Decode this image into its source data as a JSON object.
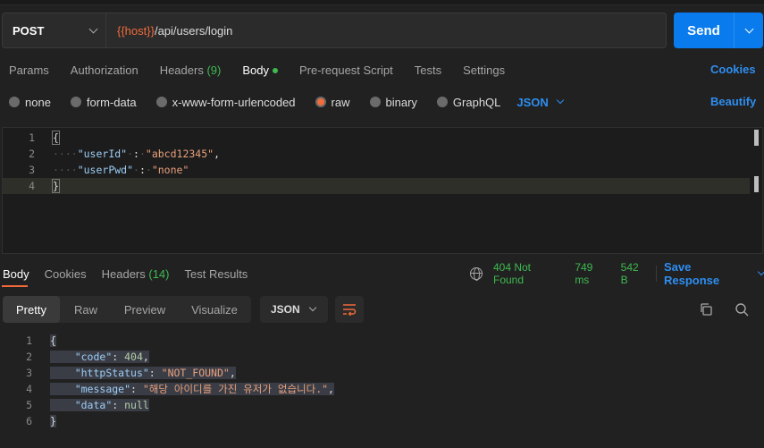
{
  "request": {
    "method": "POST",
    "url_var": "{{host}}",
    "url_path": "/api/users/login",
    "send_label": "Send"
  },
  "request_tabs": {
    "params": "Params",
    "authorization": "Authorization",
    "headers": "Headers",
    "headers_count": "(9)",
    "body": "Body",
    "prerequest": "Pre-request Script",
    "tests": "Tests",
    "settings": "Settings",
    "cookies": "Cookies"
  },
  "body_types": {
    "none": "none",
    "form_data": "form-data",
    "urlencoded": "x-www-form-urlencoded",
    "raw": "raw",
    "binary": "binary",
    "graphql": "GraphQL",
    "format": "JSON",
    "beautify": "Beautify"
  },
  "request_body": {
    "line_numbers": [
      "1",
      "2",
      "3",
      "4"
    ],
    "open_brace": "{",
    "close_brace": "}",
    "key1": "\"userId\"",
    "val1": "\"abcd12345\"",
    "key2": "\"userPwd\"",
    "val2": "\"none\""
  },
  "response_tabs": {
    "body": "Body",
    "cookies": "Cookies",
    "headers": "Headers",
    "headers_count": "(14)",
    "test_results": "Test Results"
  },
  "response_status": {
    "status": "404 Not Found",
    "time": "749 ms",
    "size": "542 B",
    "save": "Save Response"
  },
  "view_modes": {
    "pretty": "Pretty",
    "raw": "Raw",
    "preview": "Preview",
    "visualize": "Visualize",
    "format": "JSON"
  },
  "response_body": {
    "line_numbers": [
      "1",
      "2",
      "3",
      "4",
      "5",
      "6"
    ],
    "open_brace": "{",
    "close_brace": "}",
    "k_code": "\"code\"",
    "v_code": "404",
    "k_status": "\"httpStatus\"",
    "v_status": "\"NOT_FOUND\"",
    "k_message": "\"message\"",
    "v_message": "\"해당 아이디를 가진 유저가 없습니다.\"",
    "k_data": "\"data\"",
    "v_data": "null"
  },
  "colors": {
    "accent_orange": "#f26b3a",
    "accent_blue": "#097bed",
    "status_green": "#3fb950"
  }
}
